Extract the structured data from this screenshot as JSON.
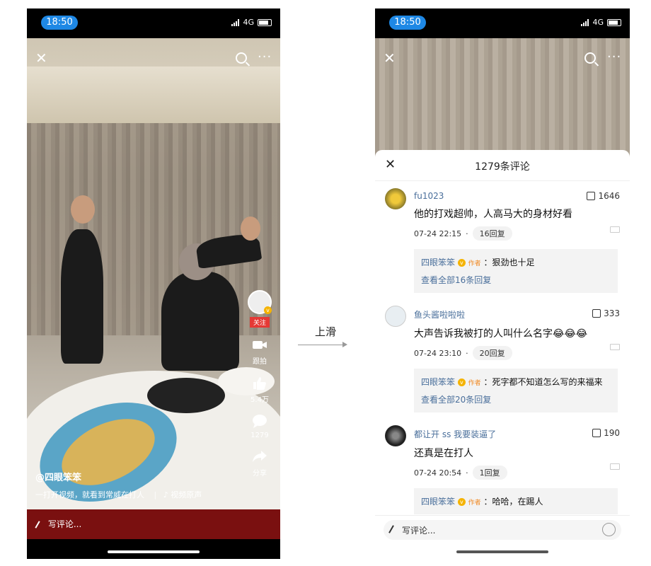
{
  "status_bar": {
    "time": "18:50",
    "network": "4G"
  },
  "left_screen": {
    "author_handle": "@四眼笨笨",
    "description": "一打开视频，就看到常威在打人",
    "music": "♪ 视频原声",
    "follow_label": "关注",
    "actions": [
      {
        "label": "跟拍",
        "icon": "camera-icon"
      },
      {
        "label": "5.4万",
        "icon": "heart-icon"
      },
      {
        "label": "1279",
        "icon": "comment-icon"
      },
      {
        "label": "分享",
        "icon": "share-icon"
      }
    ],
    "comment_placeholder": "写评论..."
  },
  "transition_label": "上滑",
  "right_screen": {
    "sheet_title": "1279条评论",
    "comments": [
      {
        "user": "fu1023",
        "likes": "1646",
        "text": "他的打戏超帅，人高马大的身材好看",
        "time": "07-24 22:15",
        "replies": "16回复",
        "reply": {
          "name": "四眼笨笨",
          "tag": "作者",
          "text": "：狠劲也十足",
          "view_all": "查看全部16条回复"
        }
      },
      {
        "user": "鱼头酱啦啦啦",
        "likes": "333",
        "text": "大声告诉我被打的人叫什么名字😂😂😂",
        "time": "07-24 23:10",
        "replies": "20回复",
        "reply": {
          "name": "四眼笨笨",
          "tag": "作者",
          "text": "：死字都不知道怎么写的来福来",
          "view_all": "查看全部20条回复"
        }
      },
      {
        "user": "都让开 ss 我要装逼了",
        "likes": "190",
        "text": "还真是在打人",
        "time": "07-24 20:54",
        "replies": "1回复",
        "reply": {
          "name": "四眼笨笨",
          "tag": "作者",
          "text": "：哈哈，在踢人",
          "view_all": ""
        }
      }
    ],
    "input_placeholder": "写评论..."
  }
}
